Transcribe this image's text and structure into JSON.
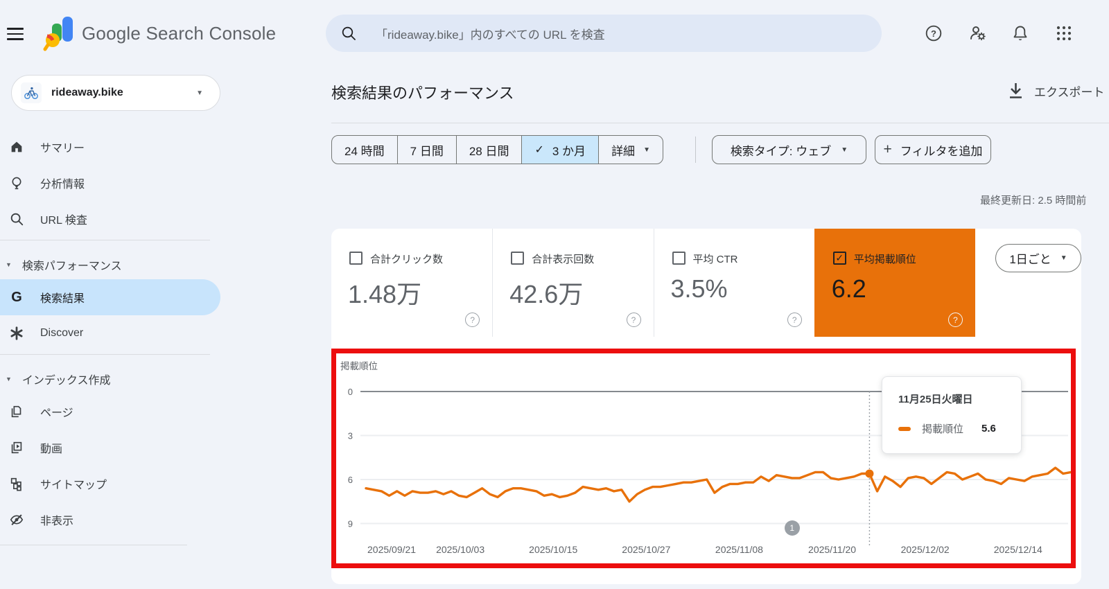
{
  "topbar": {
    "product_name": "Google Search Console",
    "search_placeholder": "「rideaway.bike」内のすべての URL を検査"
  },
  "sidebar": {
    "property_name": "rideaway.bike",
    "sections": [
      {
        "items": [
          {
            "icon": "home-icon",
            "label": "サマリー"
          },
          {
            "icon": "lightbulb-icon",
            "label": "分析情報"
          },
          {
            "icon": "search-icon",
            "label": "URL 検査"
          }
        ]
      },
      {
        "header": "検索パフォーマンス",
        "items": [
          {
            "icon": "google-g-icon",
            "label": "検索結果",
            "selected": true
          },
          {
            "icon": "asterisk-icon",
            "label": "Discover"
          }
        ]
      },
      {
        "header": "インデックス作成",
        "items": [
          {
            "icon": "pages-icon",
            "label": "ページ"
          },
          {
            "icon": "video-icon",
            "label": "動画"
          },
          {
            "icon": "sitemap-icon",
            "label": "サイトマップ"
          },
          {
            "icon": "eye-off-icon",
            "label": "非表示"
          }
        ]
      }
    ]
  },
  "main": {
    "title": "検索結果のパフォーマンス",
    "export_label": "エクスポート",
    "date_ranges": [
      {
        "label": "24 時間"
      },
      {
        "label": "7 日間"
      },
      {
        "label": "28 日間"
      },
      {
        "label": "3 か月",
        "selected": true
      },
      {
        "label": "詳細",
        "dropdown": true
      }
    ],
    "search_type_filter": "検索タイプ: ウェブ",
    "add_filter_label": "フィルタを追加",
    "last_updated": "最終更新日: 2.5 時間前",
    "granularity": "1日ごと",
    "cards": [
      {
        "label": "合計クリック数",
        "value": "1.48万",
        "checked": false
      },
      {
        "label": "合計表示回数",
        "value": "42.6万",
        "checked": false
      },
      {
        "label": "平均 CTR",
        "value": "3.5%",
        "checked": false
      },
      {
        "label": "平均掲載順位",
        "value": "6.2",
        "checked": true,
        "selected": true
      }
    ]
  },
  "chart_data": {
    "type": "line",
    "title": "掲載順位",
    "ylabel": "掲載順位",
    "y_ticks": [
      0,
      3,
      6,
      9
    ],
    "y_inverted": true,
    "grid": true,
    "x_tick_labels": [
      "2025/09/21",
      "2025/10/03",
      "2025/10/15",
      "2025/10/27",
      "2025/11/08",
      "2025/11/20",
      "2025/12/02",
      "2025/12/14"
    ],
    "x_tick_indices": [
      0,
      12,
      24,
      36,
      48,
      60,
      72,
      84
    ],
    "series": [
      {
        "name": "掲載順位",
        "color": "#e8710a",
        "values": [
          6.6,
          6.7,
          6.8,
          7.1,
          6.8,
          7.1,
          6.8,
          6.9,
          6.9,
          6.8,
          7.0,
          6.8,
          7.1,
          7.2,
          6.9,
          6.6,
          7.0,
          7.2,
          6.8,
          6.6,
          6.6,
          6.7,
          6.8,
          7.1,
          7.0,
          7.2,
          7.1,
          6.9,
          6.5,
          6.6,
          6.7,
          6.6,
          6.8,
          6.7,
          7.5,
          7.0,
          6.7,
          6.5,
          6.5,
          6.4,
          6.3,
          6.2,
          6.2,
          6.1,
          6.0,
          6.9,
          6.5,
          6.3,
          6.3,
          6.2,
          6.2,
          5.8,
          6.1,
          5.7,
          5.8,
          5.9,
          5.9,
          5.7,
          5.5,
          5.5,
          5.9,
          6.0,
          5.9,
          5.8,
          5.6,
          5.6,
          6.8,
          5.8,
          6.1,
          6.5,
          5.9,
          5.8,
          5.9,
          6.3,
          5.9,
          5.5,
          5.6,
          6.0,
          5.8,
          5.6,
          6.0,
          6.1,
          6.3,
          5.9,
          6.0,
          6.1,
          5.8,
          5.7,
          5.6,
          5.2,
          5.6,
          5.5
        ]
      }
    ],
    "hover": {
      "index": 65,
      "date_label": "11月25日火曜日",
      "series_label": "掲載順位",
      "value": "5.6"
    },
    "annotation_badge": {
      "label": "1",
      "index": 55
    }
  },
  "glyphs": {
    "check": "✓",
    "caret": "▼",
    "plus": "+",
    "question": "?"
  },
  "colors": {
    "accent_orange": "#e8710a",
    "selected_blue": "#c8e4fc",
    "segment_blue": "#cae7fb",
    "annotation_red": "#ec0e0e",
    "badge_gray": "#9aa0a6"
  }
}
